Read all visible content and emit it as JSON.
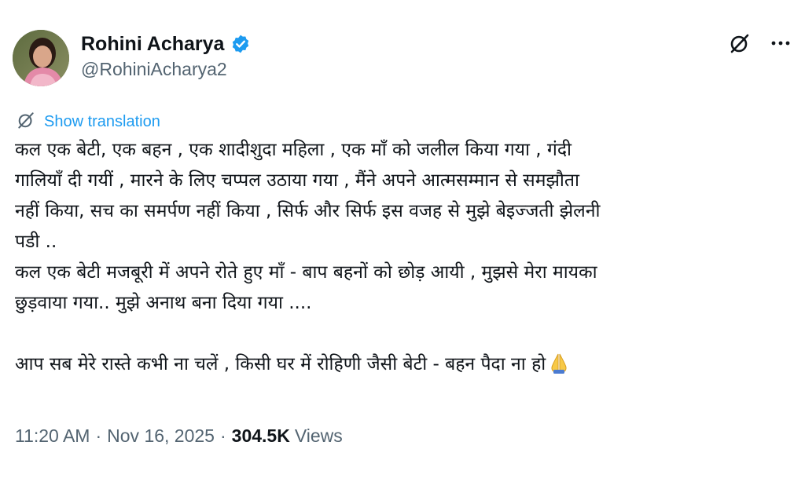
{
  "author": {
    "name": "Rohini Acharya",
    "handle": "@RohiniAcharya2",
    "verified": true
  },
  "icons": {
    "verified": "verified-badge-icon",
    "grok": "grok-icon",
    "more": "more-options-icon",
    "translate": "translate-icon",
    "emoji": "folded-hands-emoji"
  },
  "colors": {
    "link": "#1d9bf0",
    "secondary_text": "#536471",
    "primary_text": "#0f1419"
  },
  "translate": {
    "label": "Show translation"
  },
  "body": {
    "lines": [
      "कल एक बेटी, एक बहन , एक शादीशुदा महिला , एक माँ को जलील किया गया , गंदी",
      "गालियाँ दी गयीं , मारने के लिए चप्पल उठाया गया , मैंने  अपने आत्मसम्मान से समझौता",
      "नहीं किया, सच का समर्पण नहीं किया , सिर्फ और सिर्फ इस वजह से मुझे बेइज्जती झेलनी",
      "पडी ..",
      "कल एक बेटी मजबूरी में अपने रोते हुए माँ - बाप बहनों को छोड़  आयी , मुझसे मेरा मायका",
      "छुड़वाया गया.. मुझे अनाथ बना दिया गया ....",
      "",
      "आप सब मेरे रास्ते कभी ना चलें , किसी घर में रोहिणी जैसी बेटी - बहन  पैदा ना  हो"
    ]
  },
  "meta": {
    "time": "11:20 AM",
    "separator": "·",
    "date": "Nov 16, 2025",
    "views_count": "304.5K",
    "views_label": "Views"
  }
}
